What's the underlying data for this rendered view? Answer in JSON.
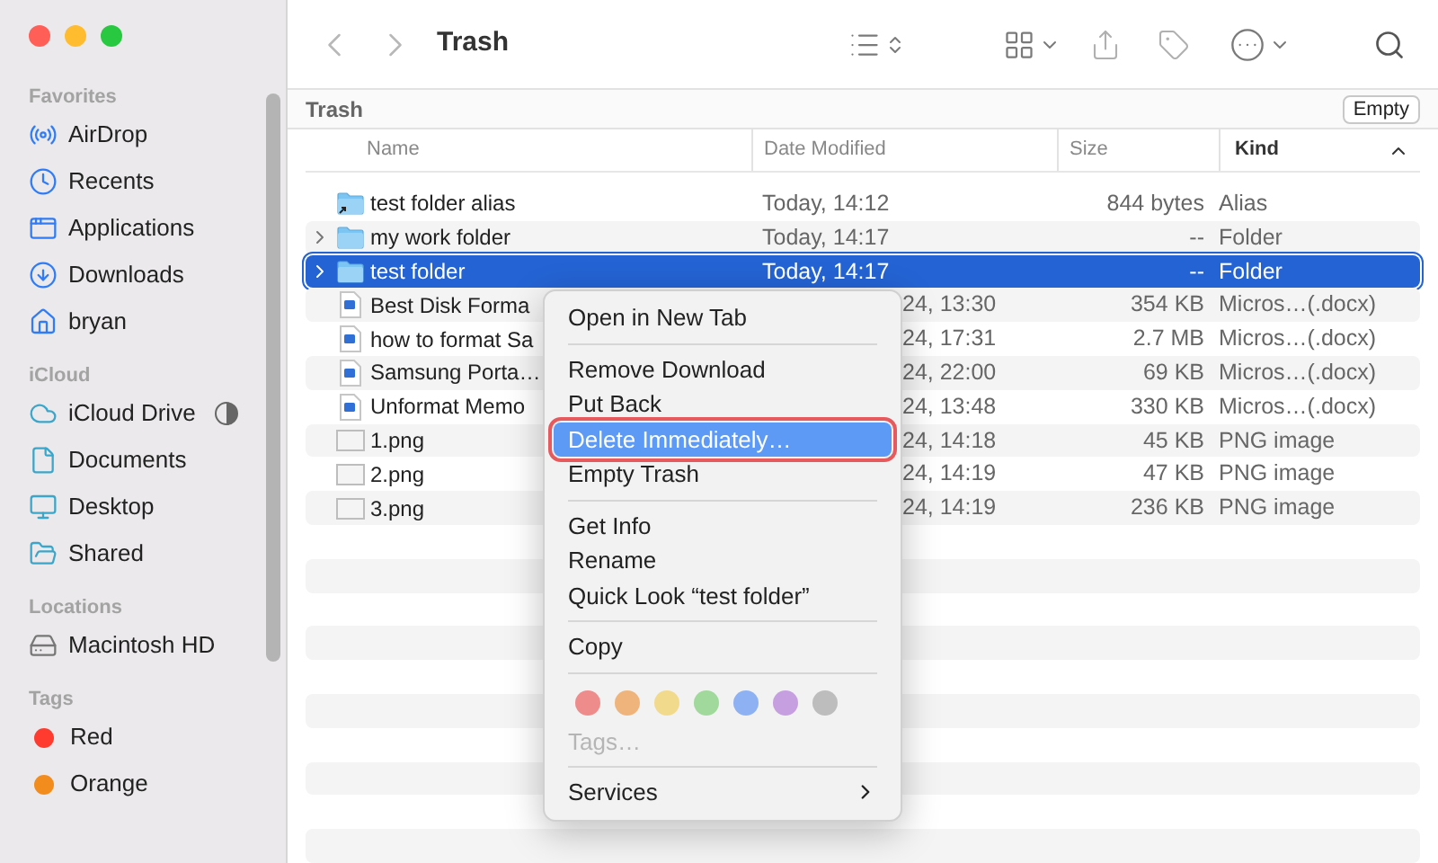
{
  "window": {
    "title": "Trash"
  },
  "sidebar": {
    "sections": [
      {
        "title": "Favorites",
        "items": [
          {
            "label": "AirDrop"
          },
          {
            "label": "Recents"
          },
          {
            "label": "Applications"
          },
          {
            "label": "Downloads"
          },
          {
            "label": "bryan"
          }
        ]
      },
      {
        "title": "iCloud",
        "items": [
          {
            "label": "iCloud Drive"
          },
          {
            "label": "Documents"
          },
          {
            "label": "Desktop"
          },
          {
            "label": "Shared"
          }
        ]
      },
      {
        "title": "Locations",
        "items": [
          {
            "label": "Macintosh HD"
          }
        ]
      },
      {
        "title": "Tags",
        "items": [
          {
            "label": "Red",
            "color": "#ff3b30"
          },
          {
            "label": "Orange",
            "color": "#f28c1c"
          }
        ]
      }
    ]
  },
  "path_bar": {
    "label": "Trash",
    "button": "Empty"
  },
  "table": {
    "columns": [
      {
        "label": "Name",
        "selected": false
      },
      {
        "label": "Date Modified",
        "selected": false
      },
      {
        "label": "Size",
        "selected": false
      },
      {
        "label": "Kind",
        "selected": true
      }
    ],
    "rows": [
      {
        "kind": "alias",
        "name": "test folder alias",
        "date": "Today, 14:12",
        "size": "844 bytes",
        "type": "Alias",
        "selected": false,
        "covered": false
      },
      {
        "kind": "folder",
        "name": "my work folder",
        "date": "Today, 14:17",
        "size": "--",
        "type": "Folder",
        "selected": false,
        "covered": false
      },
      {
        "kind": "folder",
        "name": "test folder",
        "date": "Today, 14:17",
        "size": "--",
        "type": "Folder",
        "selected": true,
        "covered": false
      },
      {
        "kind": "document",
        "name": "Best Disk Forma",
        "date": "24, 13:30",
        "size": "354 KB",
        "type": "Micros…(.docx)",
        "selected": false,
        "covered": true
      },
      {
        "kind": "document",
        "name": "how to format Sa",
        "date": "24, 17:31",
        "size": "2.7 MB",
        "type": "Micros…(.docx)",
        "selected": false,
        "covered": true
      },
      {
        "kind": "document",
        "name": "Samsung Porta…",
        "date": "24, 22:00",
        "size": "69 KB",
        "type": "Micros…(.docx)",
        "selected": false,
        "covered": true
      },
      {
        "kind": "document",
        "name": "Unformat Memo",
        "date": "24, 13:48",
        "size": "330 KB",
        "type": "Micros…(.docx)",
        "selected": false,
        "covered": true
      },
      {
        "kind": "image",
        "name": "1.png",
        "date": "24, 14:18",
        "size": "45 KB",
        "type": "PNG image",
        "selected": false,
        "covered": true
      },
      {
        "kind": "image",
        "name": "2.png",
        "date": "24, 14:19",
        "size": "47 KB",
        "type": "PNG image",
        "selected": false,
        "covered": true
      },
      {
        "kind": "image",
        "name": "3.png",
        "date": "24, 14:19",
        "size": "236 KB",
        "type": "PNG image",
        "selected": false,
        "covered": true
      }
    ]
  },
  "context_menu": {
    "items": [
      {
        "kind": "item",
        "label": "Open in New Tab",
        "selected": false,
        "disabled": false
      },
      {
        "kind": "separator"
      },
      {
        "kind": "item",
        "label": "Remove Download",
        "selected": false,
        "disabled": false
      },
      {
        "kind": "item",
        "label": "Put Back",
        "selected": false,
        "disabled": false
      },
      {
        "kind": "item",
        "label": "Delete Immediately…",
        "selected": true,
        "disabled": false
      },
      {
        "kind": "item",
        "label": "Empty Trash",
        "selected": false,
        "disabled": false
      },
      {
        "kind": "separator"
      },
      {
        "kind": "item",
        "label": "Get Info",
        "selected": false,
        "disabled": false
      },
      {
        "kind": "item",
        "label": "Rename",
        "selected": false,
        "disabled": false
      },
      {
        "kind": "item",
        "label": "Quick Look “test folder”",
        "selected": false,
        "disabled": false
      },
      {
        "kind": "separator"
      },
      {
        "kind": "item",
        "label": "Copy",
        "selected": false,
        "disabled": false
      },
      {
        "kind": "separator"
      },
      {
        "kind": "colors",
        "colors": [
          {
            "color": "#ee8c8c"
          },
          {
            "color": "#efb47c"
          },
          {
            "color": "#f2da8c"
          },
          {
            "color": "#a0d99b"
          },
          {
            "color": "#8eb1f3"
          },
          {
            "color": "#c69fe0"
          },
          {
            "color": "#bdbdbd"
          }
        ]
      },
      {
        "kind": "item",
        "label": "Tags…",
        "selected": false,
        "disabled": true
      },
      {
        "kind": "separator"
      },
      {
        "kind": "submenu",
        "label": "Services",
        "selected": false,
        "disabled": false
      }
    ]
  }
}
